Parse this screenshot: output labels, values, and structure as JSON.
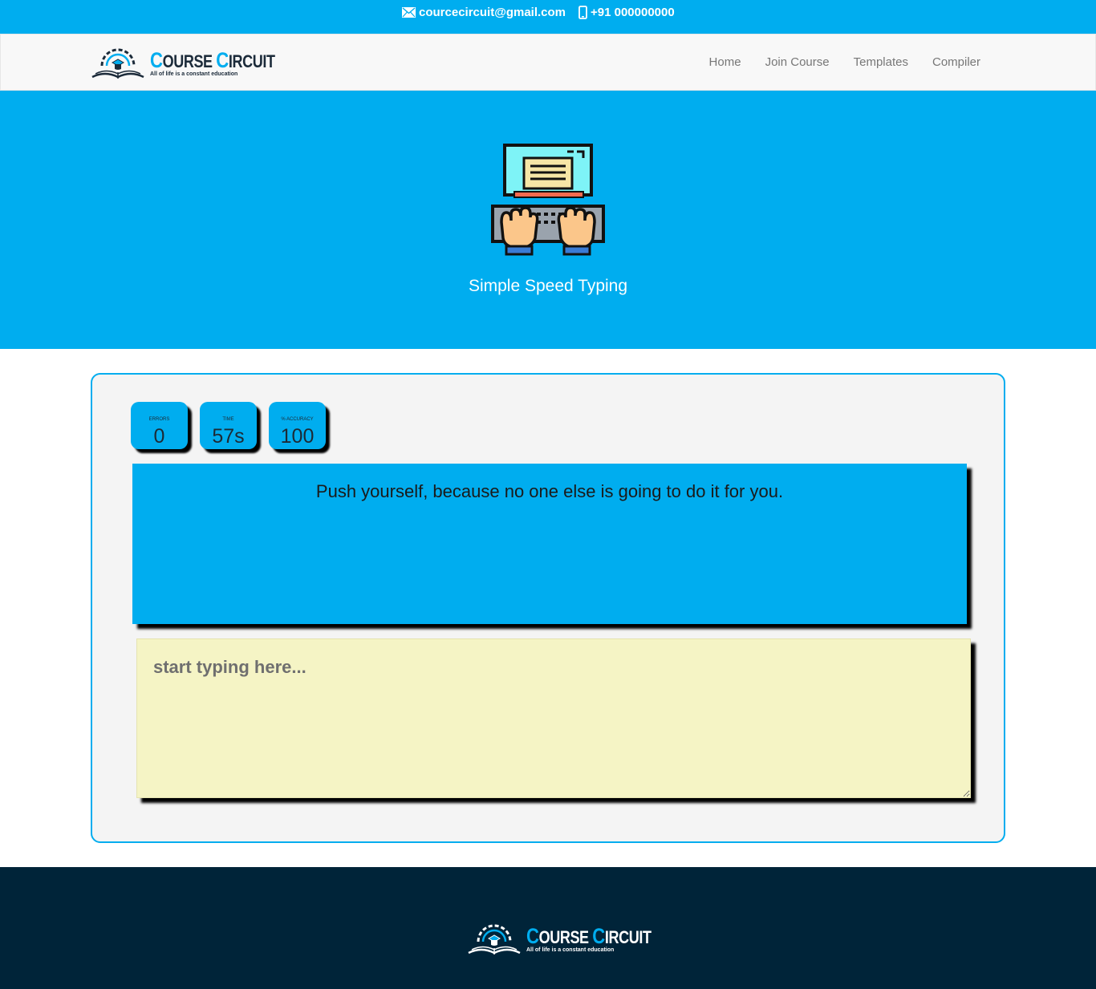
{
  "contact": {
    "email": "courcecircuit@gmail.com",
    "phone": "+91 000000000",
    "email_icon": "envelope-icon",
    "phone_icon": "mobile-phone-icon"
  },
  "brand": {
    "name_first_cap": "C",
    "name_first_rest": "OURSE",
    "name_second_cap": "C",
    "name_second_rest": "IRCUIT",
    "tagline": "All of life is a constant education"
  },
  "nav": {
    "items": [
      {
        "label": "Home"
      },
      {
        "label": "Join Course"
      },
      {
        "label": "Templates"
      },
      {
        "label": "Compiler"
      }
    ]
  },
  "hero": {
    "title": "Simple Speed Typing",
    "icon": "typing-computer-icon"
  },
  "stats": {
    "errors": {
      "label": "Errors",
      "value": "0"
    },
    "time": {
      "label": "Time",
      "value": "57s"
    },
    "accuracy": {
      "label": "% Accuracy",
      "value": "100"
    }
  },
  "quote": "Push yourself, because no one else is going to do it for you.",
  "typing": {
    "placeholder": "start typing here...",
    "value": ""
  },
  "colors": {
    "accent": "#00adef",
    "navbar_bg": "#f8f8f8",
    "card_bg": "#f4f4f4",
    "input_bg": "#f5f4c5",
    "footer_bg": "#002439"
  }
}
